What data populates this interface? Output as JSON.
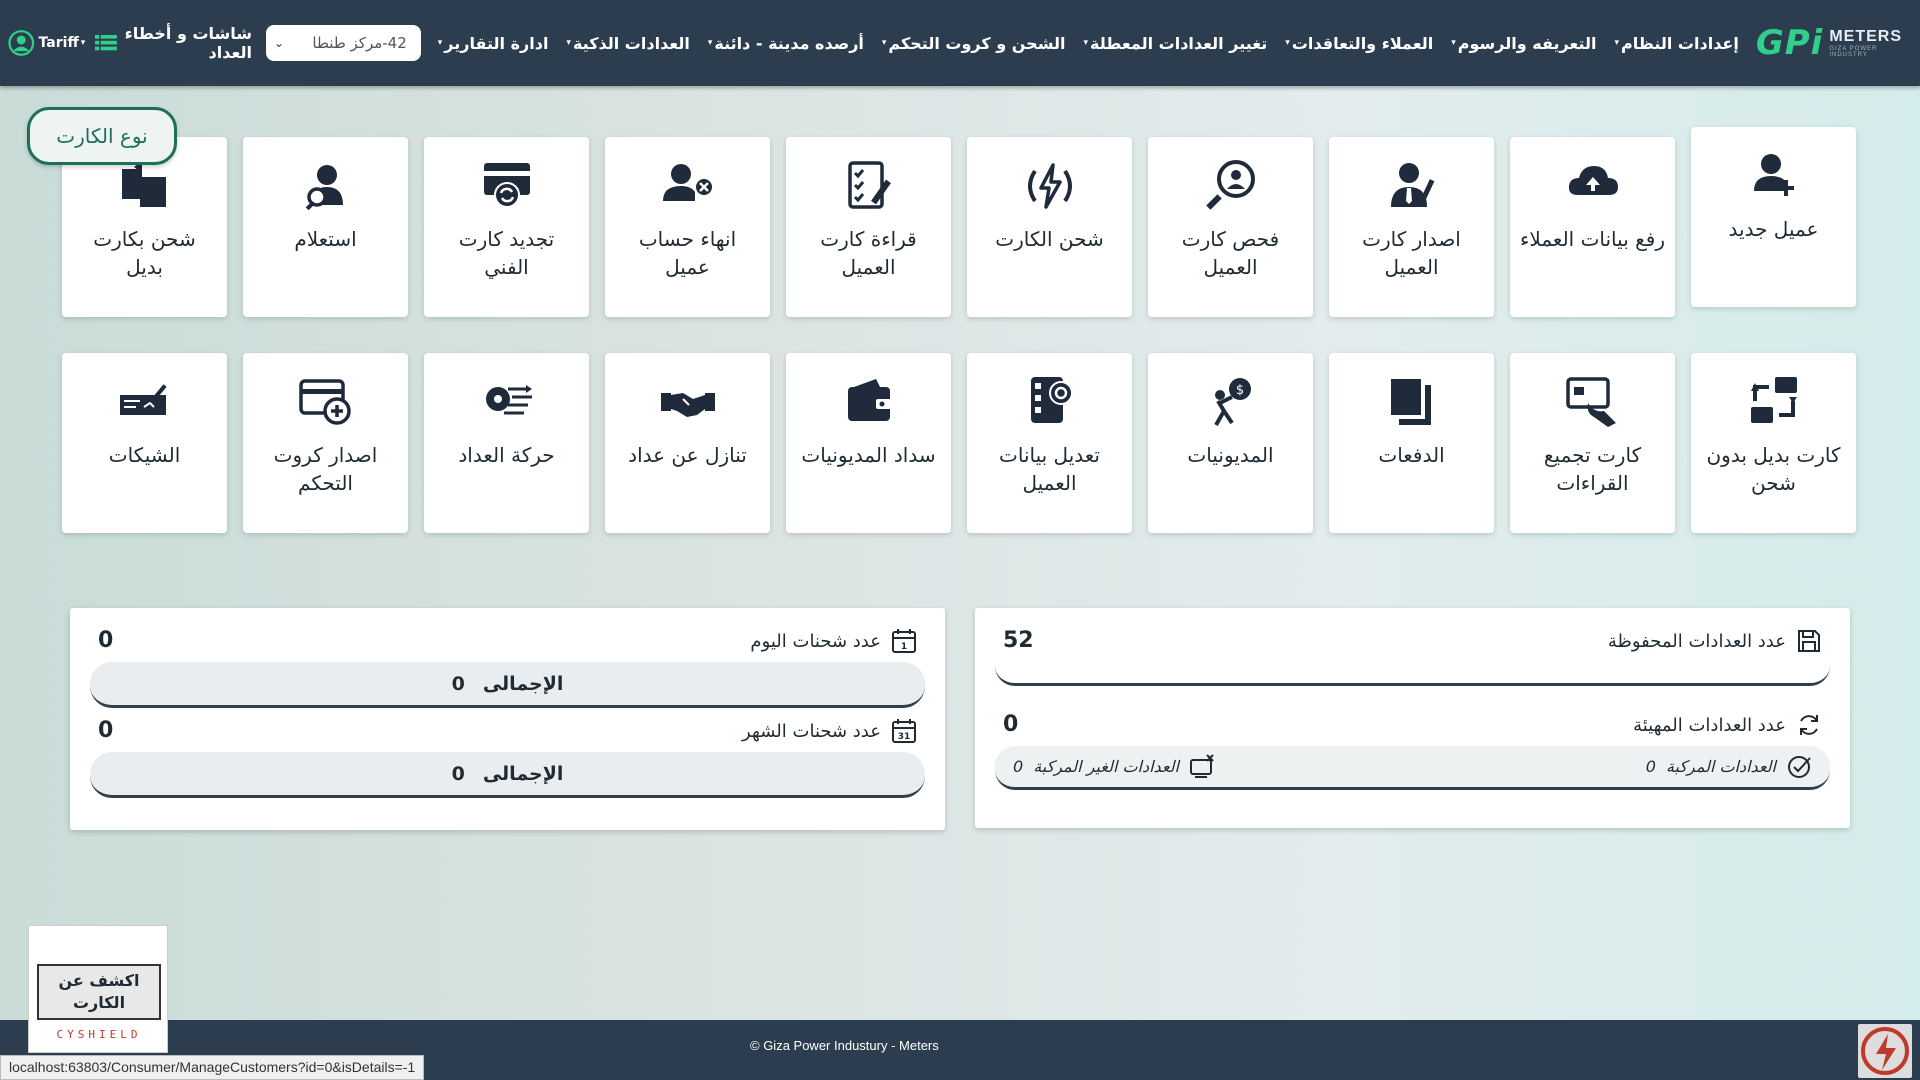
{
  "navbar": {
    "brand_gpi": "GPi",
    "brand_meters": "METERS",
    "brand_sub": "GIZA POWER INDUSTRY",
    "menu": [
      {
        "label": "إعدادات النظام",
        "dropdown": true
      },
      {
        "label": "التعريفه والرسوم",
        "dropdown": true
      },
      {
        "label": "العملاء والتعاقدات",
        "dropdown": true
      },
      {
        "label": "تغيير العدادات المعطلة",
        "dropdown": true
      },
      {
        "label": "الشحن و كروت التحكم",
        "dropdown": true
      },
      {
        "label": "أرصده مدينة - دائنة",
        "dropdown": true
      },
      {
        "label": "العدادات الذكية",
        "dropdown": true
      },
      {
        "label": "ادارة التقارير",
        "dropdown": true
      }
    ],
    "center_select": "42-مركز طنطا",
    "screens_label": "شاشات و أخطاء العداد",
    "tariff_label": "Tariff"
  },
  "card_type_label": "نوع الكارت",
  "tiles_row1": [
    {
      "label": "عميل جديد",
      "icon": "add-user-icon"
    },
    {
      "label": "رفع بيانات العملاء",
      "icon": "cloud-upload-icon"
    },
    {
      "label": "اصدار كارت العميل",
      "icon": "user-tie-icon"
    },
    {
      "label": "فحص كارت العميل",
      "icon": "search-user-icon"
    },
    {
      "label": "شحن الكارت",
      "icon": "charge-bolt-icon"
    },
    {
      "label": "قراءة كارت العميل",
      "icon": "checklist-icon"
    },
    {
      "label": "انهاء حساب عميل",
      "icon": "remove-user-icon"
    },
    {
      "label": "تجديد كارت الفني",
      "icon": "card-renew-icon"
    },
    {
      "label": "استعلام",
      "icon": "inquiry-user-icon"
    },
    {
      "label": "شحن بكارت بديل",
      "icon": "replacement-card-icon"
    }
  ],
  "tiles_row2": [
    {
      "label": "كارت بديل بدون شحن",
      "icon": "swap-icon"
    },
    {
      "label": "كارت تجميع القراءات",
      "icon": "card-collect-icon"
    },
    {
      "label": "الدفعات",
      "icon": "copies-icon"
    },
    {
      "label": "المديونيات",
      "icon": "debt-burden-icon"
    },
    {
      "label": "تعديل بيانات العميل",
      "icon": "edit-data-icon"
    },
    {
      "label": "سداد المديونيات",
      "icon": "wallet-icon"
    },
    {
      "label": "تنازل عن عداد",
      "icon": "handshake-icon"
    },
    {
      "label": "حركة العداد",
      "icon": "meter-motion-icon"
    },
    {
      "label": "اصدار كروت التحكم",
      "icon": "add-card-icon"
    },
    {
      "label": "الشيكات",
      "icon": "cheque-icon"
    }
  ],
  "stats_left": {
    "today_label": "عدد شحنات اليوم",
    "today_value": "0",
    "today_total_label": "الإجمالى",
    "today_total_value": "0",
    "month_label": "عدد شحنات الشهر",
    "month_value": "0",
    "month_total_label": "الإجمالى",
    "month_total_value": "0"
  },
  "stats_right": {
    "saved_label": "عدد العدادات المحفوظة",
    "saved_value": "52",
    "prepared_label": "عدد العدادات المهيئة",
    "prepared_value": "0",
    "mounted_label": "العدادات المركبة",
    "mounted_value": "0",
    "unmounted_label": "العدادات الغير المركبة",
    "unmounted_value": "0"
  },
  "footer": {
    "copyright": "© Giza Power Industury - Meters",
    "status_url": "localhost:63803/Consumer/ManageCustomers?id=0&isDetails=-1",
    "reveal_button": "اكشف عن الكارت",
    "cyshield": "CYSHIELD"
  },
  "colors": {
    "navbar": "#2c3d4f",
    "brand_green": "#2fd18a",
    "accent": "#1e6e5a",
    "icon_dark": "#1f2a3a"
  }
}
